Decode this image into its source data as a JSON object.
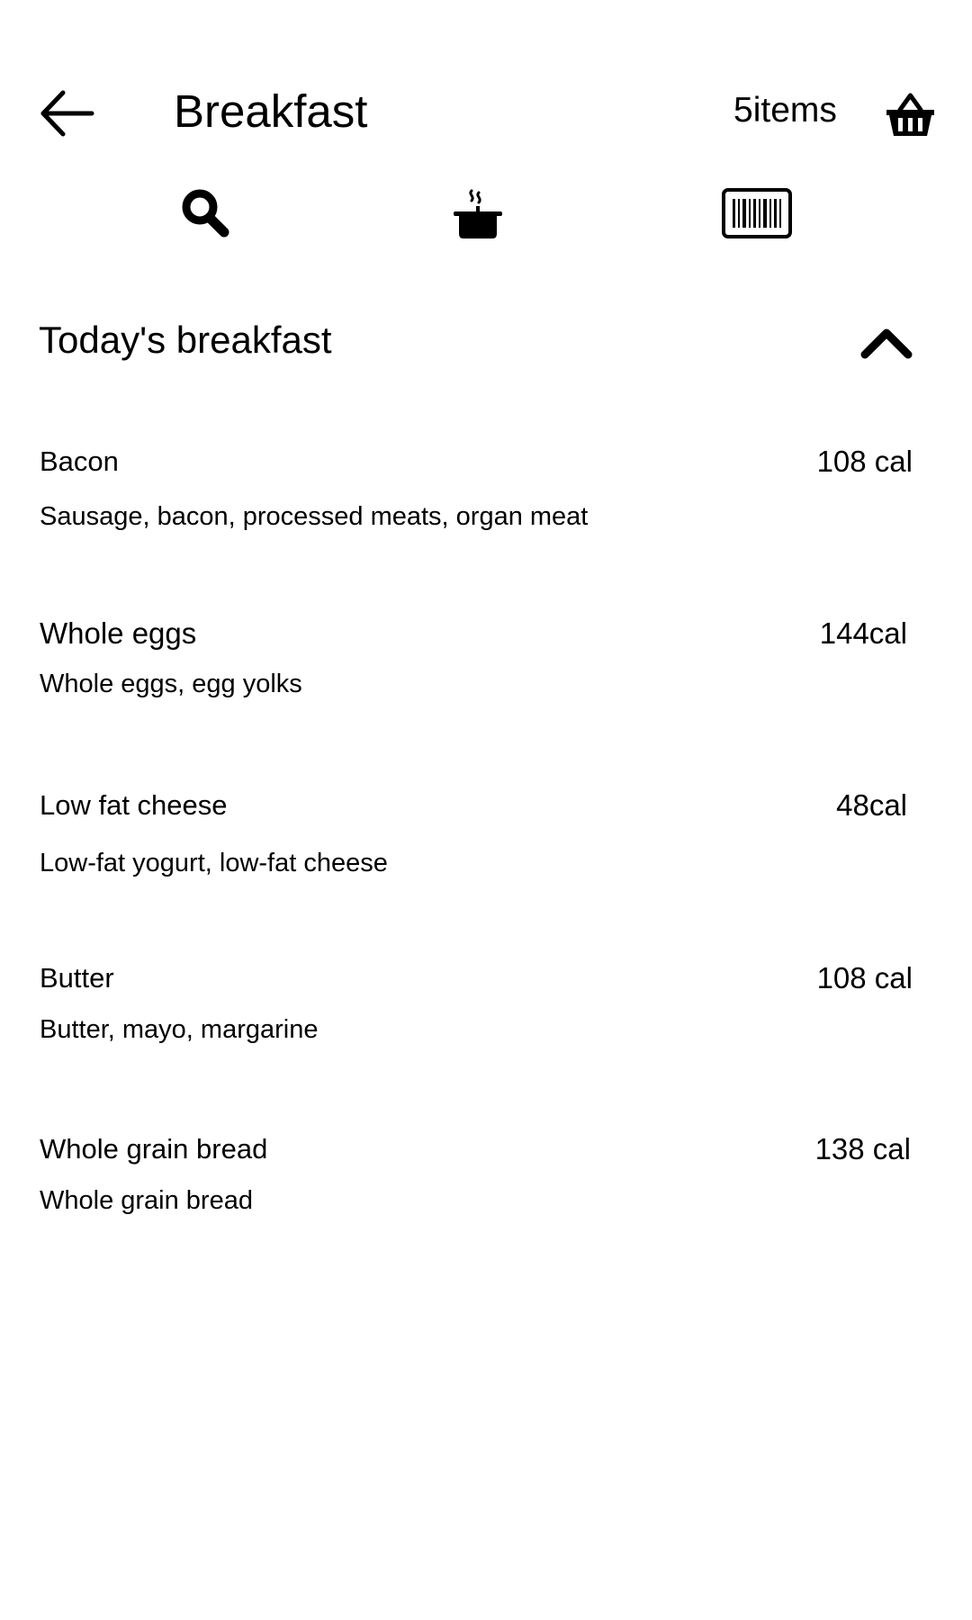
{
  "header": {
    "title": "Breakfast",
    "items_count": "5items",
    "back_icon": "arrow-left-icon",
    "basket_icon": "basket-icon"
  },
  "actions": [
    {
      "icon": "search-icon"
    },
    {
      "icon": "cooking-pot-icon"
    },
    {
      "icon": "barcode-icon"
    }
  ],
  "section": {
    "title": "Today's breakfast",
    "toggle_icon": "chevron-up-icon"
  },
  "foods": [
    {
      "name": "Bacon",
      "calories": "108 cal",
      "description": "Sausage, bacon, processed meats, organ meat"
    },
    {
      "name": "Whole eggs",
      "calories": "144cal",
      "description": "Whole eggs, egg yolks"
    },
    {
      "name": "Low fat cheese",
      "calories": "48cal",
      "description": "Low-fat yogurt, low-fat cheese"
    },
    {
      "name": "Butter",
      "calories": "108 cal",
      "description": "Butter, mayo, margarine"
    },
    {
      "name": "Whole grain bread",
      "calories": "138 cal",
      "description": "Whole grain bread"
    }
  ]
}
